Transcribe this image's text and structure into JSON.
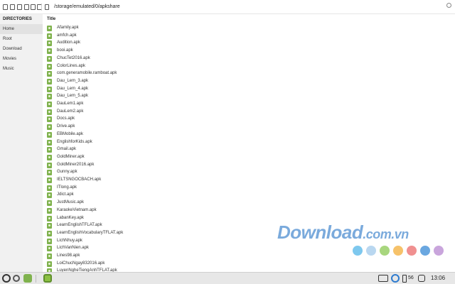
{
  "toolbar": {
    "path": "/storage/emulated/0/apkshare",
    "icons": [
      "copy-icon",
      "cut-icon",
      "delete-icon",
      "rename-icon",
      "new-file-icon",
      "new-folder-icon",
      "back-icon"
    ]
  },
  "sidebar": {
    "title": "DIRECTORIES",
    "items": [
      {
        "label": "Home",
        "active": true
      },
      {
        "label": "Root"
      },
      {
        "label": "Download"
      },
      {
        "label": "Movies"
      },
      {
        "label": "Music"
      }
    ]
  },
  "list": {
    "column_title": "Title",
    "files": [
      "Afamily.apk",
      "amfch.apk",
      "Audition.apk",
      "booi.apk",
      "ChucTet2016.apk",
      "ColorLines.apk",
      "com.generamobile.ramboat.apk",
      "Dau_Lem_3.apk",
      "Dau_Lem_4.apk",
      "Dau_Lem_5.apk",
      "DauLem1.apk",
      "DauLem2.apk",
      "Docs.apk",
      "Drive.apk",
      "EBMobile.apk",
      "EnglishforKids.apk",
      "Gmail.apk",
      "GoldMiner.apk",
      "GoldMiner2016.apk",
      "Gunny.apk",
      "IELTSNGOCBACH.apk",
      "ITlong.apk",
      "Jdict.apk",
      "JustMusic.apk",
      "KaraokeVietnam.apk",
      "LabanKey.apk",
      "LearnEnglishTFLAT.apk",
      "LearnEnglishVocabularyTFLAT.apk",
      "LichNhuy.apk",
      "LichVanNien.apk",
      "Lines98.apk",
      "LoiChucNgay832016.apk",
      "LuyenNgheTiengAnhTFLAT.apk"
    ]
  },
  "watermark": {
    "brand": "Download",
    "suffix": ".com.vn",
    "dot_colors": [
      "#7ec8ee",
      "#b9d7f0",
      "#a8d67e",
      "#f6c26a",
      "#f09090",
      "#6aa7e0",
      "#c9a5dc"
    ]
  },
  "taskbar": {
    "battery": "56",
    "clock": "13:06"
  }
}
